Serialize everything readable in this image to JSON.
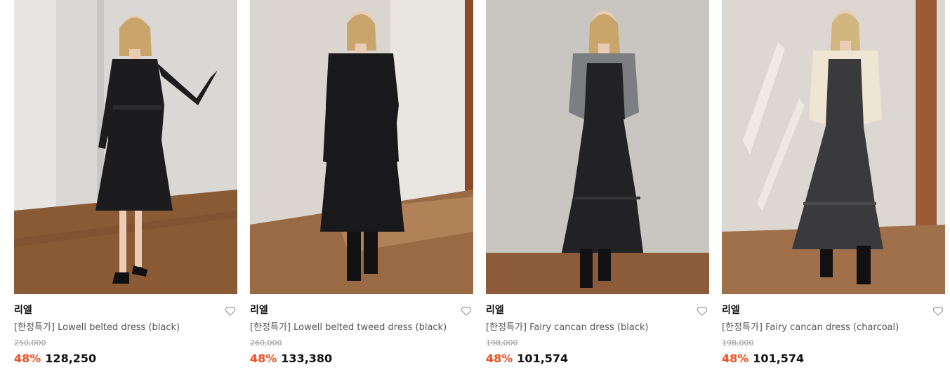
{
  "colors": {
    "discount": "#ef4f1f",
    "text": "#111111",
    "muted": "#555555",
    "strike": "#9a9a9a"
  },
  "products": [
    {
      "brand": "리엘",
      "title": "[한정특가] Lowell belted dress (black)",
      "original_price": "250,000",
      "discount": "48%",
      "price": "128,250",
      "wishlist_icon": "heart-outline-icon",
      "image": {
        "outfit": "black belted dress",
        "shoes": "black heels",
        "wall": "#d9d8d4",
        "floor": "#8a5a35",
        "dress": "#1c1c1e"
      }
    },
    {
      "brand": "리엘",
      "title": "[한정특가] Lowell belted tweed dress (black)",
      "original_price": "260,000",
      "discount": "48%",
      "price": "133,380",
      "wishlist_icon": "heart-outline-icon",
      "image": {
        "outfit": "black tweed dress",
        "shoes": "black boots",
        "wall": "#dad6cf",
        "floor": "#9a6a44",
        "dress": "#19191b"
      }
    },
    {
      "brand": "리엘",
      "title": "[한정특가] Fairy cancan dress (black)",
      "original_price": "198,000",
      "discount": "48%",
      "price": "101,574",
      "wishlist_icon": "heart-outline-icon",
      "image": {
        "outfit": "black tiered dress with grey cardigan",
        "shoes": "black boots",
        "wall": "#c9c6c1",
        "floor": "#8c5b3a",
        "dress": "#222224"
      }
    },
    {
      "brand": "리엘",
      "title": "[한정특가] Fairy cancan dress (charcoal)",
      "original_price": "198,000",
      "discount": "48%",
      "price": "101,574",
      "wishlist_icon": "heart-outline-icon",
      "image": {
        "outfit": "charcoal tiered dress with cream cardigan",
        "shoes": "black boots",
        "wall": "#dcd8d1",
        "floor": "#a0704a",
        "dress": "#3a3a3c"
      }
    }
  ]
}
